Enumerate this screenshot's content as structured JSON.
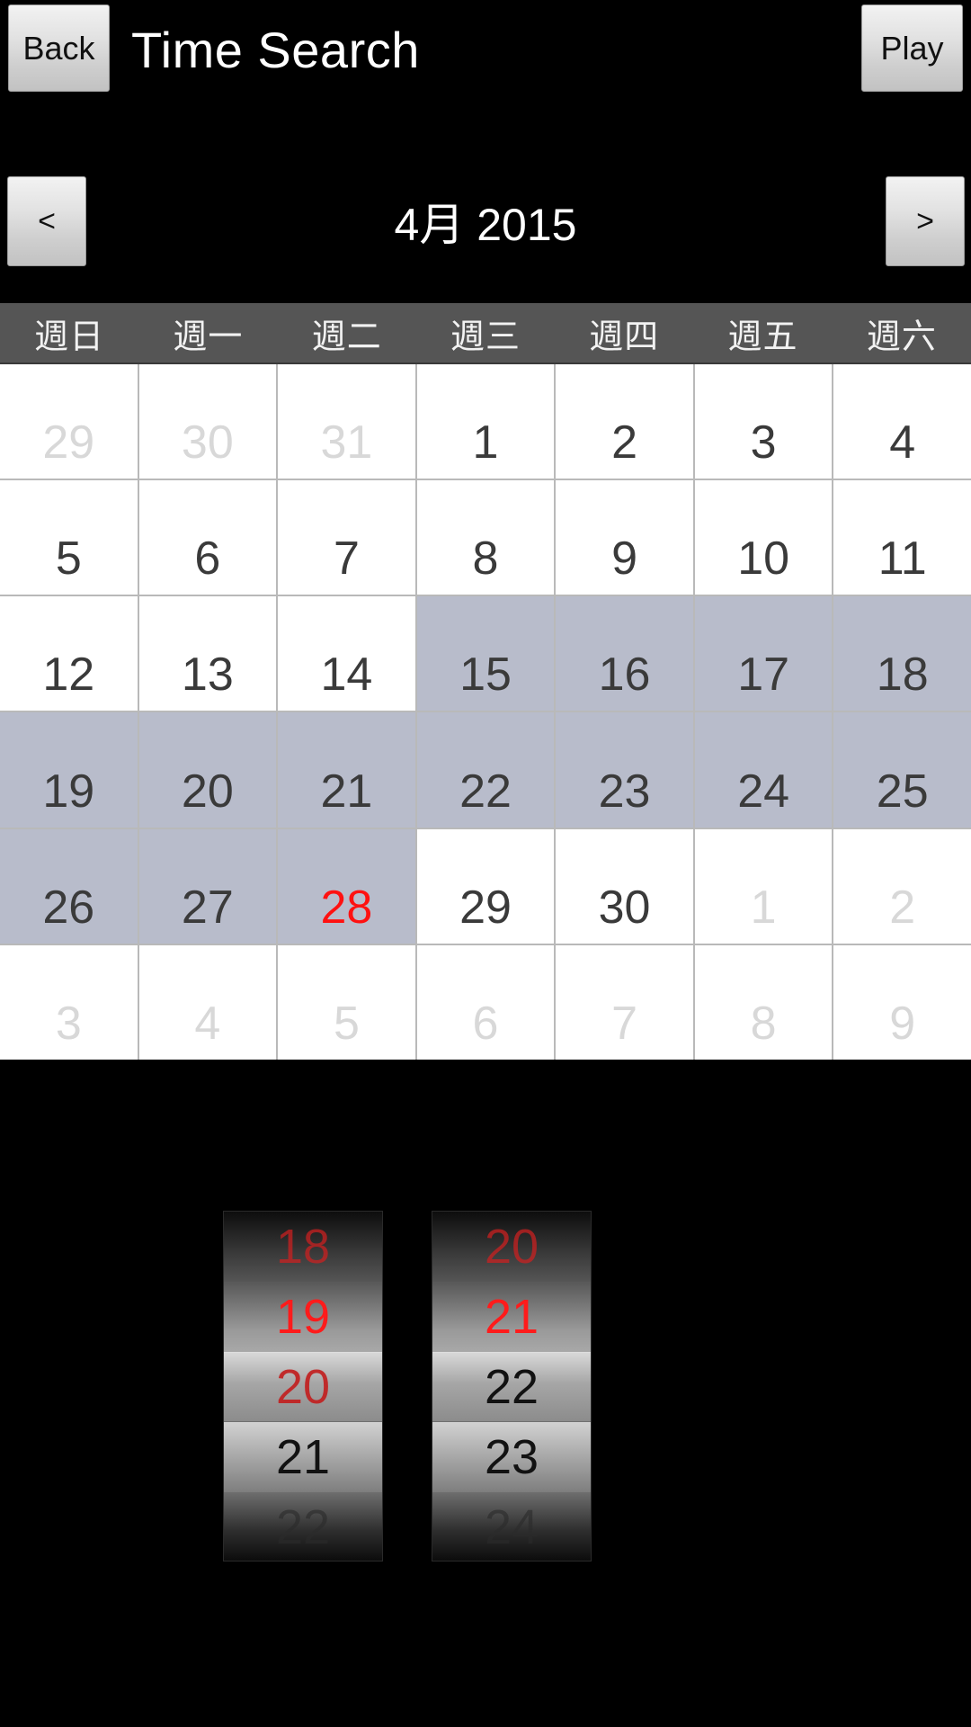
{
  "header": {
    "back_label": "Back",
    "title": "Time Search",
    "play_label": "Play"
  },
  "month_nav": {
    "prev_label": "<",
    "next_label": ">",
    "month_year": "4月 2015"
  },
  "calendar": {
    "weekdays": [
      "週日",
      "週一",
      "週二",
      "週三",
      "週四",
      "週五",
      "週六"
    ],
    "selected_bg": "#b8bccb",
    "today_color": "#ff1111",
    "other_month_color": "#d8d8d8",
    "weeks": [
      [
        {
          "d": "29",
          "other": true,
          "sel": false,
          "today": false
        },
        {
          "d": "30",
          "other": true,
          "sel": false,
          "today": false
        },
        {
          "d": "31",
          "other": true,
          "sel": false,
          "today": false
        },
        {
          "d": "1",
          "other": false,
          "sel": false,
          "today": false
        },
        {
          "d": "2",
          "other": false,
          "sel": false,
          "today": false
        },
        {
          "d": "3",
          "other": false,
          "sel": false,
          "today": false
        },
        {
          "d": "4",
          "other": false,
          "sel": false,
          "today": false
        }
      ],
      [
        {
          "d": "5",
          "other": false,
          "sel": false,
          "today": false
        },
        {
          "d": "6",
          "other": false,
          "sel": false,
          "today": false
        },
        {
          "d": "7",
          "other": false,
          "sel": false,
          "today": false
        },
        {
          "d": "8",
          "other": false,
          "sel": false,
          "today": false
        },
        {
          "d": "9",
          "other": false,
          "sel": false,
          "today": false
        },
        {
          "d": "10",
          "other": false,
          "sel": false,
          "today": false
        },
        {
          "d": "11",
          "other": false,
          "sel": false,
          "today": false
        }
      ],
      [
        {
          "d": "12",
          "other": false,
          "sel": false,
          "today": false
        },
        {
          "d": "13",
          "other": false,
          "sel": false,
          "today": false
        },
        {
          "d": "14",
          "other": false,
          "sel": false,
          "today": false
        },
        {
          "d": "15",
          "other": false,
          "sel": true,
          "today": false
        },
        {
          "d": "16",
          "other": false,
          "sel": true,
          "today": false
        },
        {
          "d": "17",
          "other": false,
          "sel": true,
          "today": false
        },
        {
          "d": "18",
          "other": false,
          "sel": true,
          "today": false
        }
      ],
      [
        {
          "d": "19",
          "other": false,
          "sel": true,
          "today": false
        },
        {
          "d": "20",
          "other": false,
          "sel": true,
          "today": false
        },
        {
          "d": "21",
          "other": false,
          "sel": true,
          "today": false
        },
        {
          "d": "22",
          "other": false,
          "sel": true,
          "today": false
        },
        {
          "d": "23",
          "other": false,
          "sel": true,
          "today": false
        },
        {
          "d": "24",
          "other": false,
          "sel": true,
          "today": false
        },
        {
          "d": "25",
          "other": false,
          "sel": true,
          "today": false
        }
      ],
      [
        {
          "d": "26",
          "other": false,
          "sel": true,
          "today": false
        },
        {
          "d": "27",
          "other": false,
          "sel": true,
          "today": false
        },
        {
          "d": "28",
          "other": false,
          "sel": true,
          "today": true
        },
        {
          "d": "29",
          "other": false,
          "sel": false,
          "today": false
        },
        {
          "d": "30",
          "other": false,
          "sel": false,
          "today": false
        },
        {
          "d": "1",
          "other": true,
          "sel": false,
          "today": false
        },
        {
          "d": "2",
          "other": true,
          "sel": false,
          "today": false
        }
      ],
      [
        {
          "d": "3",
          "other": true,
          "sel": false,
          "today": false
        },
        {
          "d": "4",
          "other": true,
          "sel": false,
          "today": false
        },
        {
          "d": "5",
          "other": true,
          "sel": false,
          "today": false
        },
        {
          "d": "6",
          "other": true,
          "sel": false,
          "today": false
        },
        {
          "d": "7",
          "other": true,
          "sel": false,
          "today": false
        },
        {
          "d": "8",
          "other": true,
          "sel": false,
          "today": false
        },
        {
          "d": "9",
          "other": true,
          "sel": false,
          "today": false
        }
      ]
    ]
  },
  "time_picker": {
    "separator": ":",
    "hour": {
      "selected": "20",
      "rows": [
        {
          "v": "18",
          "style": "dimred"
        },
        {
          "v": "19",
          "style": "red"
        },
        {
          "v": "20",
          "style": "redfade"
        },
        {
          "v": "21",
          "style": "dark"
        },
        {
          "v": "22",
          "style": "dimdark"
        }
      ]
    },
    "minute": {
      "selected": "22",
      "rows": [
        {
          "v": "20",
          "style": "dimred"
        },
        {
          "v": "21",
          "style": "red"
        },
        {
          "v": "22",
          "style": "dark"
        },
        {
          "v": "23",
          "style": "dark"
        },
        {
          "v": "24",
          "style": "dimdark"
        }
      ]
    }
  }
}
